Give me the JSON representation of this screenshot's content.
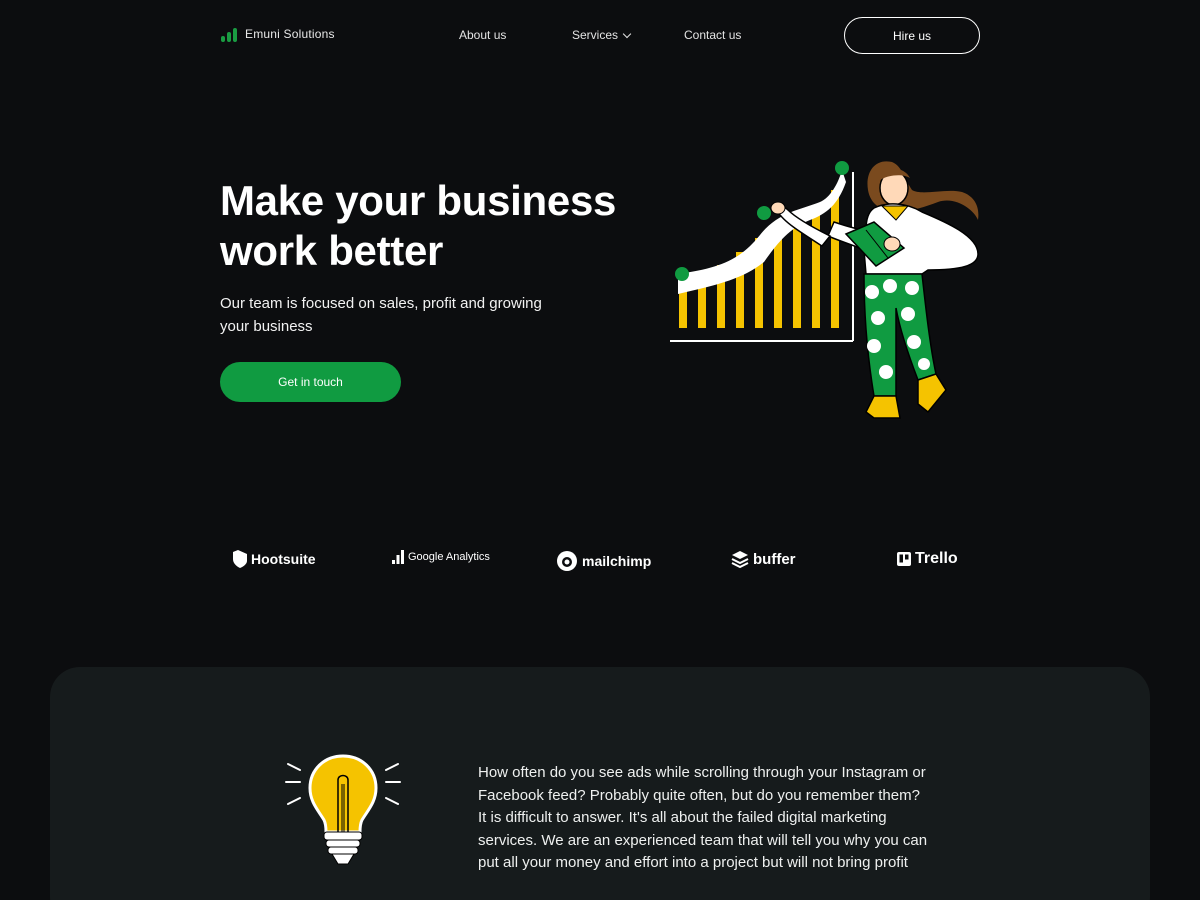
{
  "nav": {
    "brand": "Emuni Solutions",
    "links": [
      "About us",
      "Services",
      "Contact us"
    ],
    "hire_label": "Hire us"
  },
  "hero": {
    "title_line1": "Make your business",
    "title_line2": "work better",
    "subtitle_line1": "Our team is focused on sales, profit and growing",
    "subtitle_line2": "your business",
    "cta_label": "Get in touch"
  },
  "partners": [
    "Hootsuite",
    "Google Analytics",
    "mailchimp",
    "buffer",
    "Trello"
  ],
  "about": {
    "lines": [
      "How often do you see ads while scrolling through your Instagram or",
      "Facebook feed? Probably quite often, but do you remember them?",
      "It is difficult to answer. It's all about the failed digital marketing",
      "services. We are an experienced team that will tell you why you can",
      "put all your money and effort into a project but will not bring profit"
    ]
  },
  "colors": {
    "background": "#0c0d0f",
    "accent": "#109b41",
    "panel": "#161b1c",
    "chart_yellow": "#f5c300"
  },
  "icons": [
    "bars-logo-icon",
    "chevron-down-icon",
    "growth-chart-illustration",
    "lightbulb-icon"
  ]
}
